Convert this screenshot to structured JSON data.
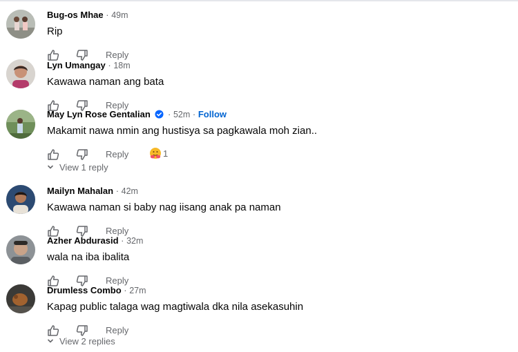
{
  "actions": {
    "reply_label": "Reply"
  },
  "comments": [
    {
      "name": "Bug-os Mhae",
      "sep": " · ",
      "time": "49m",
      "text": "Rip"
    },
    {
      "name": "Lyn Umangay",
      "sep": " · ",
      "time": "18m",
      "text": "Kawawa naman ang bata"
    },
    {
      "name": "May Lyn Rose Gentalian",
      "sep": " · ",
      "time": "52m",
      "follow": "Follow",
      "verified": true,
      "text": "Makamit nawa nmin ang hustisya sa pagkawala moh zian..",
      "reaction_count": "1",
      "reaction_icon": "hug-emoji-icon",
      "view_replies": "View 1 reply"
    },
    {
      "name": "Mailyn Mahalan",
      "sep": " · ",
      "time": "42m",
      "text": "Kawawa naman si baby nag iisang anak pa naman"
    },
    {
      "name": "Azher Abdurasid",
      "sep": " · ",
      "time": "32m",
      "text": "wala na iba ibalita"
    },
    {
      "name": "Drumless Combo",
      "sep": " · ",
      "time": "27m",
      "text": "Kapag public talaga wag magtiwala dka nila asekasuhin",
      "view_replies": "View 2 replies"
    }
  ],
  "colors": {
    "link_blue": "#0064d1",
    "muted": "#65676b",
    "verified": "#0866ff"
  }
}
